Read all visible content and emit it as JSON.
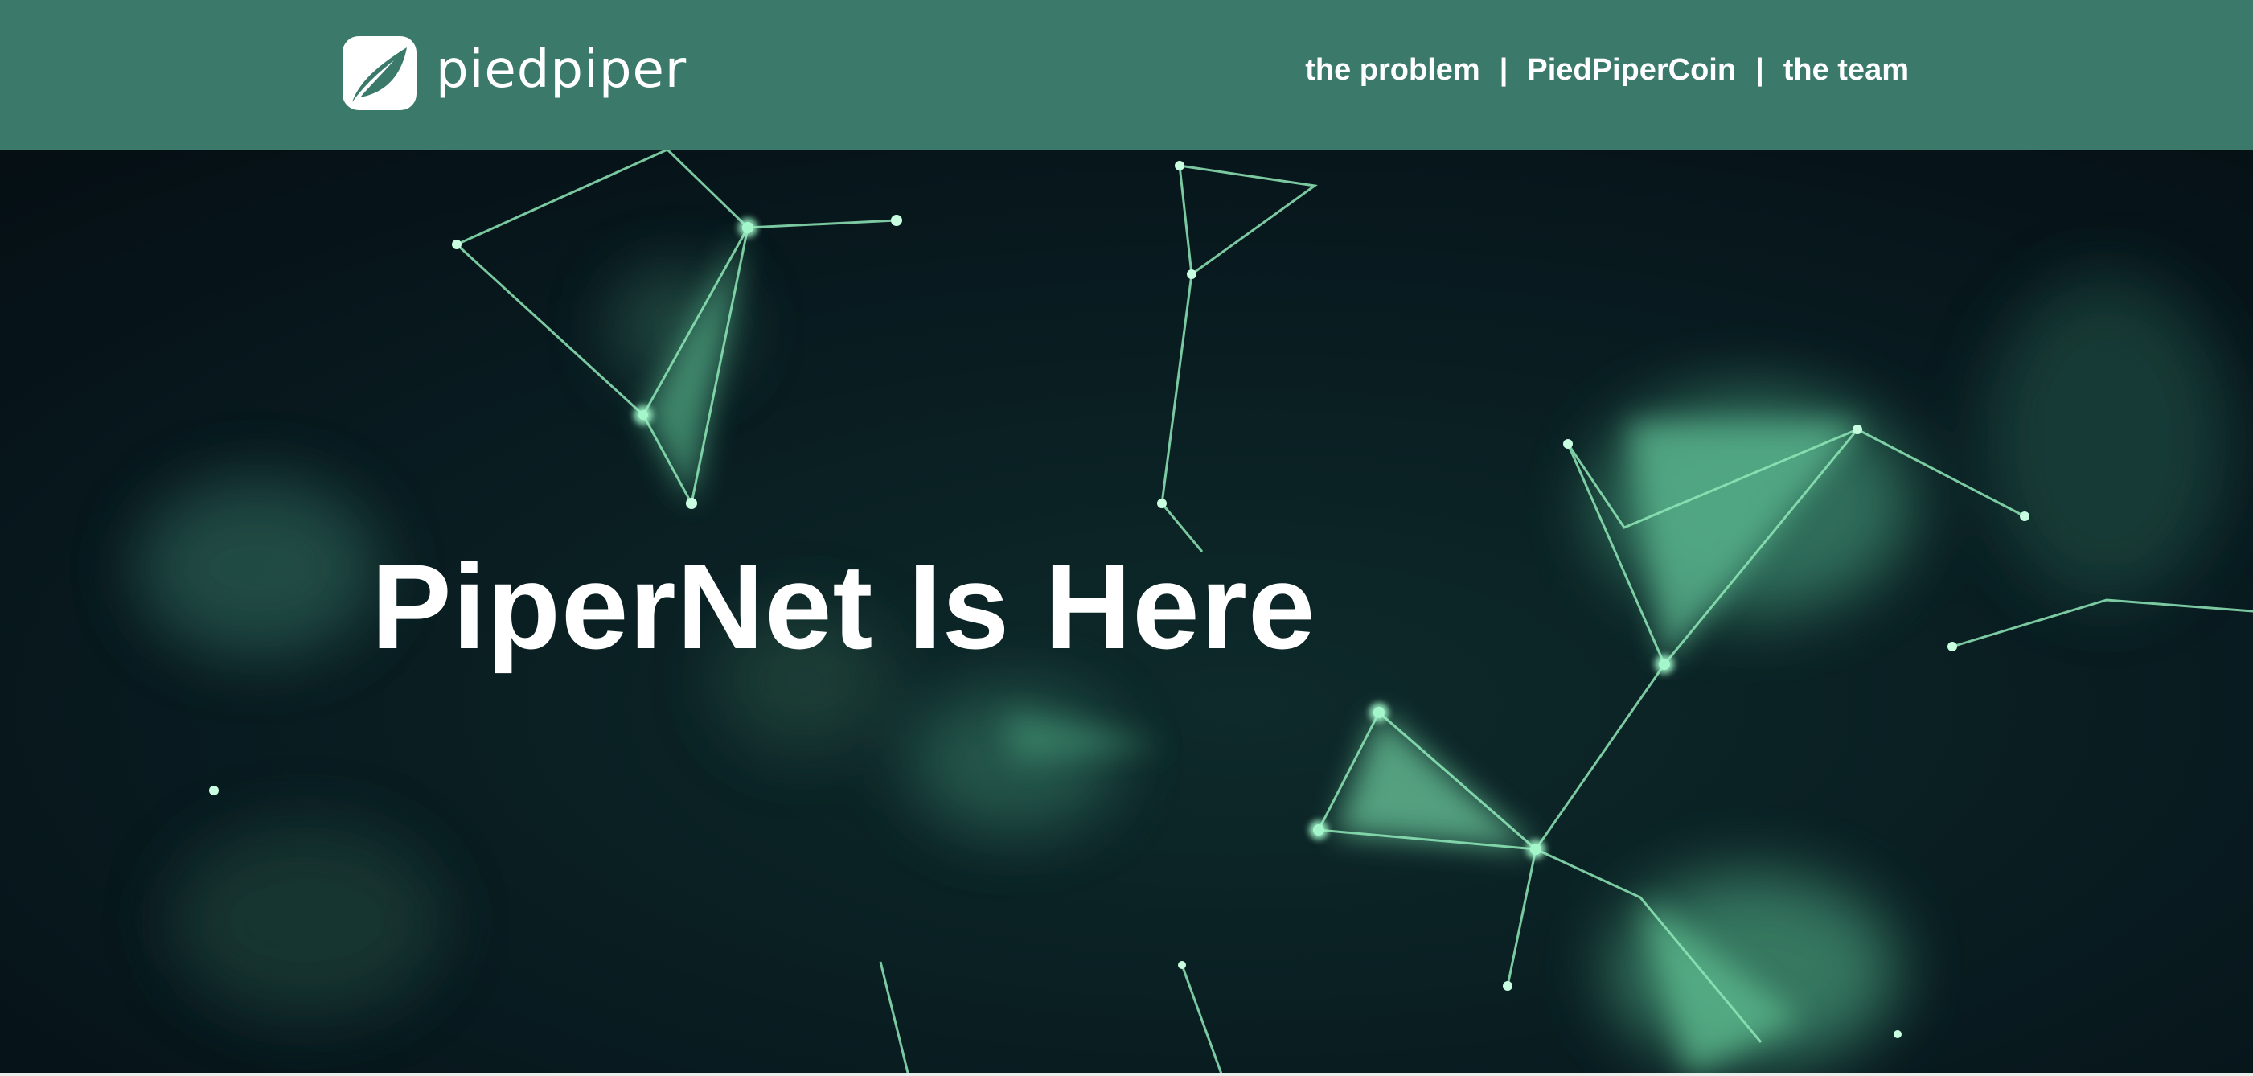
{
  "brand": {
    "name": "piedpiper",
    "logo_icon": "leaf-icon"
  },
  "nav": {
    "items": [
      {
        "label": "the problem"
      },
      {
        "label": "PiedPiperCoin"
      },
      {
        "label": "the team"
      }
    ],
    "separator": "|"
  },
  "hero": {
    "title": "PiperNet Is Here",
    "background": "network-mesh-image"
  },
  "colors": {
    "navbar": "#3b7a6b",
    "hero_bg": "#06141a",
    "accent_green": "#7ee0a8",
    "text": "#ffffff"
  }
}
